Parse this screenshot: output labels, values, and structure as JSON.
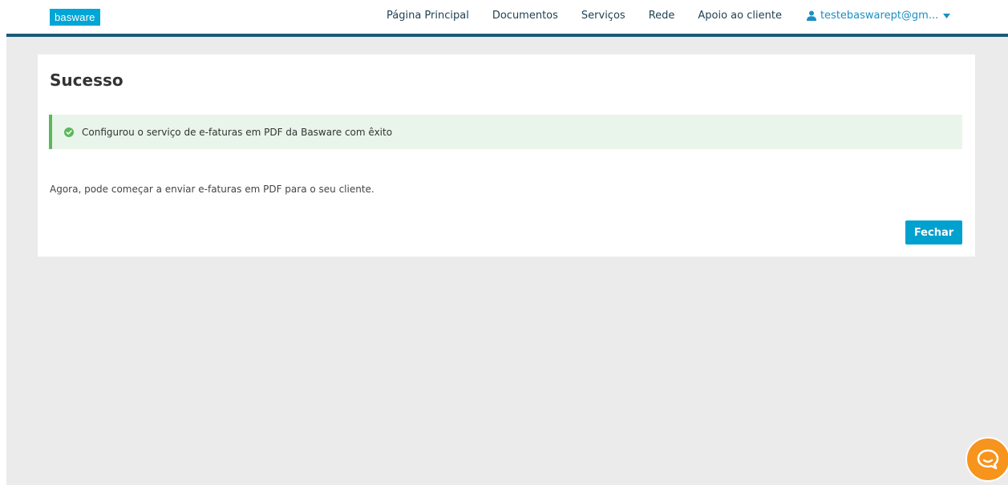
{
  "brand": {
    "logo_text": "basware",
    "logo_color": "#00a6d6",
    "nav_border_color": "#1b5a75"
  },
  "nav": {
    "items": [
      {
        "label": "Página Principal"
      },
      {
        "label": "Documentos"
      },
      {
        "label": "Serviços"
      },
      {
        "label": "Rede"
      },
      {
        "label": "Apoio ao cliente"
      }
    ],
    "user": {
      "label": "testebaswarept@gm...",
      "icon": "user-icon",
      "dropdown_icon": "caret-down-icon"
    }
  },
  "card": {
    "title": "Sucesso",
    "alert": {
      "icon": "check-circle-icon",
      "text": "Configurou o serviço de e-faturas em PDF da Basware com êxito",
      "color": "#5cb85c"
    },
    "body": "Agora, pode começar a enviar e-faturas em PDF para o seu cliente.",
    "close_label": "Fechar",
    "button_color": "#00a0cf"
  },
  "chat": {
    "icon": "chat-icon",
    "color": "#f7941d"
  }
}
